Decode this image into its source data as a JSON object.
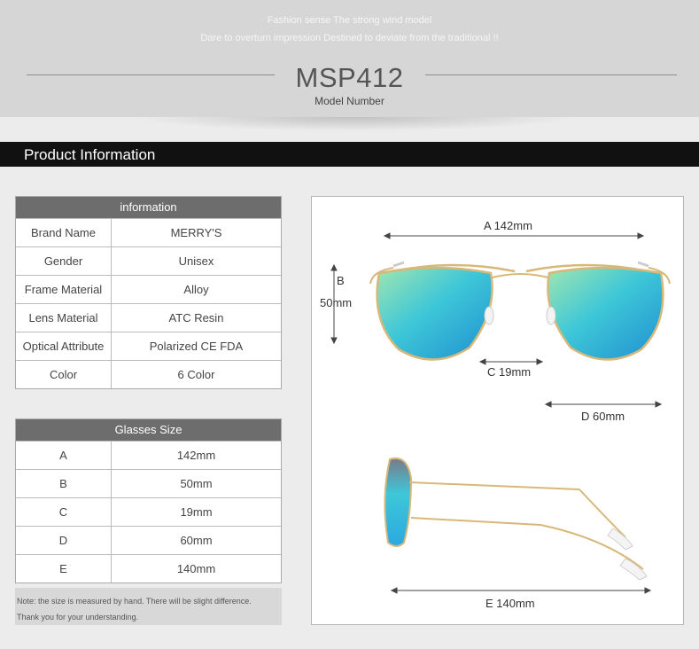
{
  "hero": {
    "tagline1": "Fashion sense The strong wind model",
    "tagline2": "Dare to overturn impression Destined to deviate from the traditional !!",
    "model": "MSP412",
    "model_label": "Model Number"
  },
  "section": {
    "title": "Product Information"
  },
  "info_table": {
    "header": "information",
    "rows": [
      {
        "label": "Brand Name",
        "value": "MERRY'S"
      },
      {
        "label": "Gender",
        "value": "Unisex"
      },
      {
        "label": "Frame Material",
        "value": "Alloy"
      },
      {
        "label": "Lens Material",
        "value": "ATC Resin"
      },
      {
        "label": "Optical Attribute",
        "value": "Polarized CE FDA"
      },
      {
        "label": "Color",
        "value": "6 Color"
      }
    ]
  },
  "size_table": {
    "header": "Glasses Size",
    "rows": [
      {
        "label": "A",
        "value": "142mm"
      },
      {
        "label": "B",
        "value": "50mm"
      },
      {
        "label": "C",
        "value": "19mm"
      },
      {
        "label": "D",
        "value": "60mm"
      },
      {
        "label": "E",
        "value": "140mm"
      }
    ]
  },
  "note": {
    "line1": "Note: the size is measured by hand. There will be slight difference.",
    "line2": "Thank you for your understanding."
  },
  "diagram": {
    "a": "A 142mm",
    "b_letter": "B",
    "b_value": "50mm",
    "c": "C 19mm",
    "d": "D 60mm",
    "e": "E 140mm",
    "lens_color": "#3ec7d8",
    "frame_color": "#d8b878"
  }
}
